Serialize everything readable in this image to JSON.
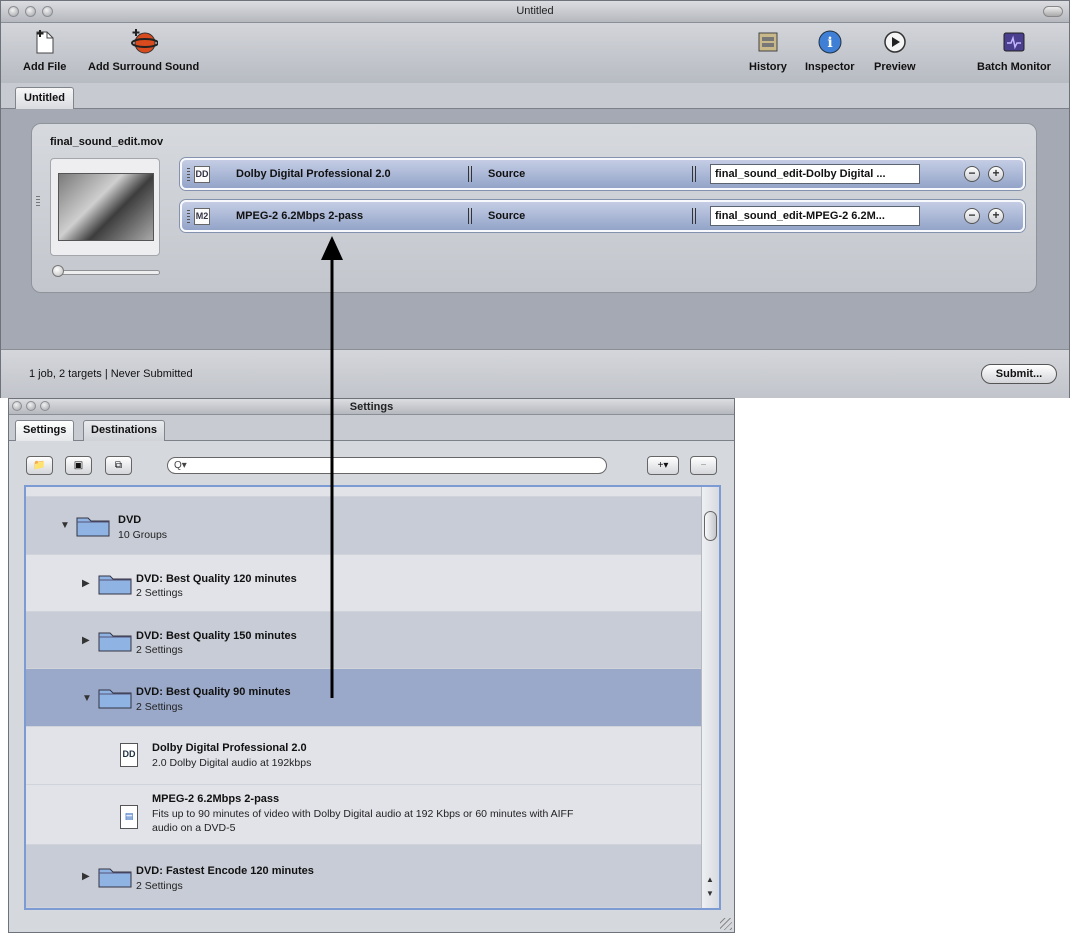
{
  "main_window": {
    "title": "Untitled",
    "toolbar": {
      "add_file": "Add File",
      "add_surround": "Add Surround Sound",
      "history": "History",
      "inspector": "Inspector",
      "preview": "Preview",
      "batch_monitor": "Batch Monitor"
    },
    "tab": "Untitled",
    "job": {
      "file_name": "final_sound_edit.mov",
      "targets": [
        {
          "icon_text": "DD",
          "name": "Dolby Digital Professional 2.0",
          "source": "Source",
          "destination": "final_sound_edit-Dolby Digital ..."
        },
        {
          "icon_text": "M2",
          "name": "MPEG-2 6.2Mbps 2-pass",
          "source": "Source",
          "destination": "final_sound_edit-MPEG-2 6.2M..."
        }
      ]
    },
    "status": "1 job, 2 targets   |   Never Submitted",
    "submit": "Submit..."
  },
  "settings_window": {
    "title": "Settings",
    "tabs": [
      "Settings",
      "Destinations"
    ],
    "search_placeholder": "Q▾",
    "tree": [
      {
        "title": "DVD",
        "subtitle": "10 Groups"
      },
      {
        "title": "DVD: Best Quality 120 minutes",
        "subtitle": "2 Settings"
      },
      {
        "title": "DVD: Best Quality 150 minutes",
        "subtitle": "2 Settings"
      },
      {
        "title": "DVD: Best Quality 90 minutes",
        "subtitle": "2 Settings"
      },
      {
        "title": "Dolby Digital Professional 2.0",
        "subtitle": "2.0 Dolby Digital audio at 192kbps"
      },
      {
        "title": "MPEG-2 6.2Mbps 2-pass",
        "subtitle": "Fits up to 90 minutes of video with Dolby Digital audio at 192 Kbps or 60 minutes with AIFF",
        "subtitle2": "audio on a DVD-5"
      },
      {
        "title": "DVD: Fastest Encode 120 minutes",
        "subtitle": "2 Settings"
      }
    ]
  },
  "colors": {
    "target_fill": "#93a4c9",
    "selection": "#9aa9c9",
    "list_focus": "#7c9ad4"
  }
}
